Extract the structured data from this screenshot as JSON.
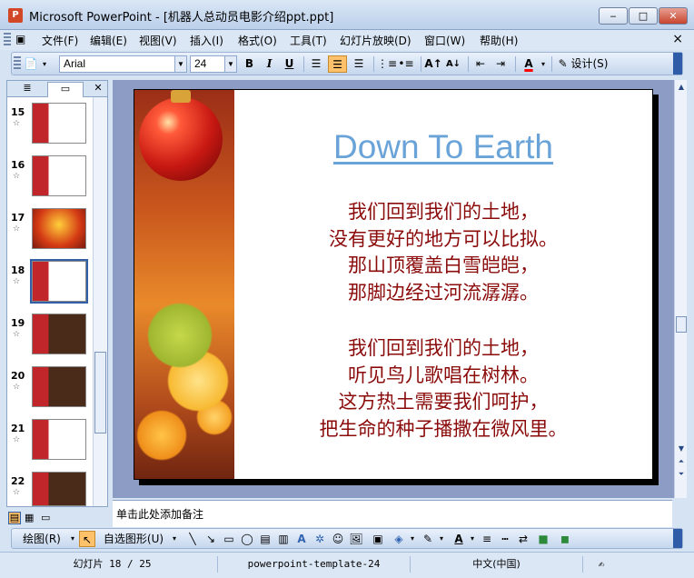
{
  "window": {
    "app_icon": "powerpoint-icon",
    "title": "Microsoft PowerPoint - [机器人总动员电影介绍ppt.ppt]",
    "min": "‒",
    "max": "□",
    "close": "✕"
  },
  "menu": {
    "items": [
      "文件(F)",
      "编辑(E)",
      "视图(V)",
      "插入(I)",
      "格式(O)",
      "工具(T)",
      "幻灯片放映(D)",
      "窗口(W)",
      "帮助(H)"
    ],
    "close": "×"
  },
  "toolbar": {
    "font_name": "Arial",
    "font_size": "24",
    "bold": "B",
    "italic": "I",
    "underline": "U",
    "design_label": "设计(S)",
    "font_color": "#ff0000"
  },
  "thumbnails": [
    {
      "num": "15",
      "star": "☆"
    },
    {
      "num": "16",
      "star": "☆"
    },
    {
      "num": "17",
      "star": "☆"
    },
    {
      "num": "18",
      "star": "☆",
      "selected": true
    },
    {
      "num": "19",
      "star": "☆"
    },
    {
      "num": "20",
      "star": "☆"
    },
    {
      "num": "21",
      "star": "☆"
    },
    {
      "num": "22",
      "star": "☆"
    }
  ],
  "slide": {
    "title": "Down To Earth",
    "stanza1": [
      "我们回到我们的土地，",
      "没有更好的地方可以比拟。",
      "那山顶覆盖白雪皑皑，",
      "那脚边经过河流潺潺。"
    ],
    "stanza2": [
      "我们回到我们的土地，",
      "听见鸟儿歌唱在树林。",
      "这方热土需要我们呵护，",
      "把生命的种子播撒在微风里。"
    ]
  },
  "notes": {
    "placeholder": "单击此处添加备注"
  },
  "draw": {
    "draw_label": "绘图(R)",
    "autoshape_label": "自选图形(U)"
  },
  "status": {
    "slide_info": "幻灯片 18 / 25",
    "template": "powerpoint-template-24",
    "language": "中文(中国)"
  }
}
